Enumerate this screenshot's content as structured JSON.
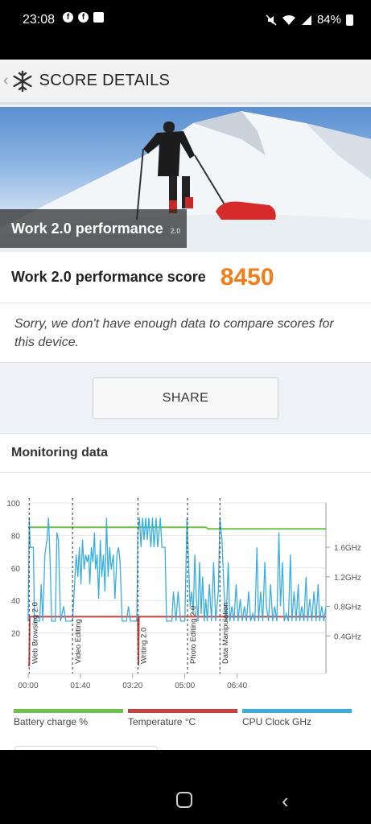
{
  "status": {
    "time": "23:08",
    "battery": "84%",
    "left_icons": [
      "facebook-icon",
      "facebook-icon",
      "image-icon"
    ],
    "right_icons": [
      "mute-icon",
      "wifi-icon",
      "signal-icon",
      "battery-icon"
    ]
  },
  "header": {
    "title": "SCORE DETAILS"
  },
  "hero": {
    "caption": "Work 2.0 performance",
    "caption_tail": "2.0"
  },
  "score": {
    "label": "Work 2.0 performance score",
    "value": "8450",
    "value_color": "#f07d1a"
  },
  "note": "Sorry, we don't have enough data to compare scores for this device.",
  "share_label": "SHARE",
  "monitoring": {
    "title": "Monitoring data",
    "legend": [
      {
        "label": "Battery charge %",
        "color": "#6cc24a"
      },
      {
        "label": "Temperature °C",
        "color": "#c94040"
      },
      {
        "label": "CPU Clock GHz",
        "color": "#3aaee0"
      }
    ]
  },
  "chart_data": {
    "type": "line",
    "x_range_sec": [
      0,
      570
    ],
    "x_ticks": [
      "00:00",
      "01:40",
      "03:20",
      "05:00",
      "06:40"
    ],
    "left_axis": {
      "ylim": [
        0,
        100
      ],
      "ticks": [
        "20",
        "40",
        "60",
        "80",
        "100"
      ]
    },
    "right_axis": {
      "ylim": [
        0,
        2.2
      ],
      "ticks": [
        "0.4GHz",
        "0.8GHz",
        "1.2GHz",
        "1.6GHz"
      ]
    },
    "markers": [
      {
        "t": 2,
        "label": "Web Browsing 2.0"
      },
      {
        "t": 85,
        "label": "Video Editing"
      },
      {
        "t": 210,
        "label": "Writing 2.0"
      },
      {
        "t": 305,
        "label": "Photo Editing 2.0"
      },
      {
        "t": 367,
        "label": "Data Manipulation"
      }
    ],
    "series": [
      {
        "name": "Battery charge %",
        "axis": "left",
        "color": "#6cc24a",
        "points": [
          [
            0,
            85
          ],
          [
            340,
            85
          ],
          [
            345,
            84
          ],
          [
            570,
            84
          ]
        ]
      },
      {
        "name": "Temperature °C",
        "axis": "left",
        "color": "#c94040",
        "points": [
          [
            0,
            0
          ],
          [
            2,
            0
          ],
          [
            3,
            30
          ],
          [
            210,
            30
          ],
          [
            211,
            0
          ],
          [
            212,
            30
          ],
          [
            570,
            30
          ]
        ]
      },
      {
        "name": "CPU Clock GHz",
        "axis": "right",
        "color": "#3aaee0",
        "points": [
          [
            0,
            0.6
          ],
          [
            2,
            2.0
          ],
          [
            4,
            1.6
          ],
          [
            10,
            1.6
          ],
          [
            12,
            0.6
          ],
          [
            22,
            0.6
          ],
          [
            25,
            1.1
          ],
          [
            28,
            0.6
          ],
          [
            32,
            1.5
          ],
          [
            36,
            1.7
          ],
          [
            39,
            2.0
          ],
          [
            42,
            1.4
          ],
          [
            45,
            0.6
          ],
          [
            52,
            0.6
          ],
          [
            55,
            1.8
          ],
          [
            58,
            1.7
          ],
          [
            62,
            0.6
          ],
          [
            68,
            0.8
          ],
          [
            72,
            0.6
          ],
          [
            80,
            0.6
          ],
          [
            85,
            0.6
          ],
          [
            88,
            1.0
          ],
          [
            92,
            1.5
          ],
          [
            95,
            1.2
          ],
          [
            98,
            1.6
          ],
          [
            101,
            1.1
          ],
          [
            104,
            1.7
          ],
          [
            107,
            1.3
          ],
          [
            110,
            1.5
          ],
          [
            113,
            1.4
          ],
          [
            116,
            1.5
          ],
          [
            118,
            1.1
          ],
          [
            121,
            1.6
          ],
          [
            124,
            1.4
          ],
          [
            127,
            1.8
          ],
          [
            129,
            1.3
          ],
          [
            132,
            1.5
          ],
          [
            135,
            0.9
          ],
          [
            138,
            1.7
          ],
          [
            141,
            1.2
          ],
          [
            144,
            1.5
          ],
          [
            147,
            1.0
          ],
          [
            150,
            2.0
          ],
          [
            153,
            1.2
          ],
          [
            156,
            1.6
          ],
          [
            159,
            1.3
          ],
          [
            163,
            1.5
          ],
          [
            166,
            0.9
          ],
          [
            170,
            1.5
          ],
          [
            173,
            1.6
          ],
          [
            176,
            1.4
          ],
          [
            180,
            0.6
          ],
          [
            188,
            0.6
          ],
          [
            192,
            0.8
          ],
          [
            196,
            0.6
          ],
          [
            208,
            0.6
          ],
          [
            210,
            1.8
          ],
          [
            213,
            2.0
          ],
          [
            216,
            1.6
          ],
          [
            219,
            2.0
          ],
          [
            222,
            1.7
          ],
          [
            225,
            2.0
          ],
          [
            228,
            1.7
          ],
          [
            231,
            2.0
          ],
          [
            235,
            1.6
          ],
          [
            238,
            2.0
          ],
          [
            241,
            1.6
          ],
          [
            245,
            2.0
          ],
          [
            248,
            1.6
          ],
          [
            253,
            2.0
          ],
          [
            256,
            1.6
          ],
          [
            262,
            1.6
          ],
          [
            265,
            0.6
          ],
          [
            275,
            0.6
          ],
          [
            278,
            1.0
          ],
          [
            283,
            0.6
          ],
          [
            287,
            1.0
          ],
          [
            292,
            0.6
          ],
          [
            300,
            0.6
          ],
          [
            304,
            2.0
          ],
          [
            307,
            1.4
          ],
          [
            310,
            0.8
          ],
          [
            313,
            1.0
          ],
          [
            316,
            0.7
          ],
          [
            319,
            1.5
          ],
          [
            322,
            0.9
          ],
          [
            325,
            0.6
          ],
          [
            328,
            1.4
          ],
          [
            331,
            0.7
          ],
          [
            334,
            1.2
          ],
          [
            337,
            0.6
          ],
          [
            340,
            0.9
          ],
          [
            343,
            0.6
          ],
          [
            347,
            1.1
          ],
          [
            351,
            0.6
          ],
          [
            355,
            1.4
          ],
          [
            359,
            0.6
          ],
          [
            364,
            1.0
          ],
          [
            367,
            2.0
          ],
          [
            371,
            1.7
          ],
          [
            375,
            1.0
          ],
          [
            379,
            0.6
          ],
          [
            383,
            1.4
          ],
          [
            386,
            0.6
          ],
          [
            390,
            0.8
          ],
          [
            394,
            0.6
          ],
          [
            398,
            1.1
          ],
          [
            402,
            0.6
          ],
          [
            406,
            0.9
          ],
          [
            410,
            0.6
          ],
          [
            414,
            0.8
          ],
          [
            418,
            0.6
          ],
          [
            422,
            1.0
          ],
          [
            426,
            0.6
          ],
          [
            430,
            0.7
          ],
          [
            434,
            0.6
          ],
          [
            438,
            1.6
          ],
          [
            441,
            0.6
          ],
          [
            445,
            1.0
          ],
          [
            449,
            0.6
          ],
          [
            453,
            1.4
          ],
          [
            456,
            0.8
          ],
          [
            460,
            0.6
          ],
          [
            464,
            1.1
          ],
          [
            468,
            0.6
          ],
          [
            472,
            0.8
          ],
          [
            476,
            0.6
          ],
          [
            480,
            1.8
          ],
          [
            483,
            0.8
          ],
          [
            487,
            1.4
          ],
          [
            490,
            0.6
          ],
          [
            494,
            0.7
          ],
          [
            498,
            0.6
          ],
          [
            502,
            1.5
          ],
          [
            505,
            0.6
          ],
          [
            509,
            1.0
          ],
          [
            513,
            0.6
          ],
          [
            517,
            1.1
          ],
          [
            520,
            0.6
          ],
          [
            524,
            0.8
          ],
          [
            528,
            0.6
          ],
          [
            532,
            1.2
          ],
          [
            535,
            0.6
          ],
          [
            539,
            0.9
          ],
          [
            543,
            0.6
          ],
          [
            547,
            1.0
          ],
          [
            551,
            0.6
          ],
          [
            555,
            1.1
          ],
          [
            558,
            0.6
          ],
          [
            562,
            0.8
          ],
          [
            566,
            0.6
          ],
          [
            570,
            0.8
          ]
        ]
      }
    ]
  }
}
